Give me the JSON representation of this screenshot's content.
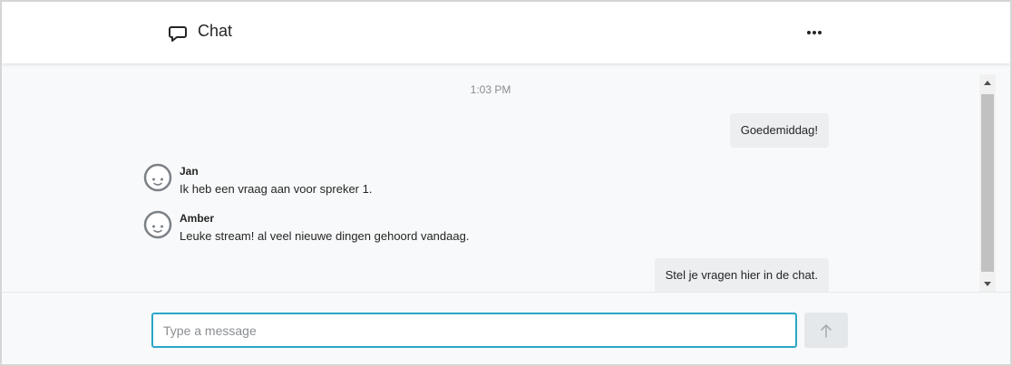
{
  "header": {
    "title": "Chat",
    "icon": "speech-bubble-icon",
    "more_icon": "more-horizontal-icon"
  },
  "messages": {
    "timestamp": "1:03 PM",
    "outgoing": [
      {
        "text": "Goedemiddag!"
      },
      {
        "text": "Stel je vragen hier in de chat."
      }
    ],
    "incoming": [
      {
        "name": "Jan",
        "text": "Ik heb een vraag aan voor spreker 1.",
        "avatar": "smiley-avatar-icon"
      },
      {
        "name": "Amber",
        "text": "Leuke stream! al veel nieuwe dingen gehoord vandaag.",
        "avatar": "smiley-avatar-icon"
      }
    ]
  },
  "composer": {
    "placeholder": "Type a message",
    "value": "",
    "send_icon": "arrow-up-icon"
  },
  "colors": {
    "accent": "#2aa6c8",
    "bubble": "#eceef0",
    "background": "#f8f9fa"
  }
}
